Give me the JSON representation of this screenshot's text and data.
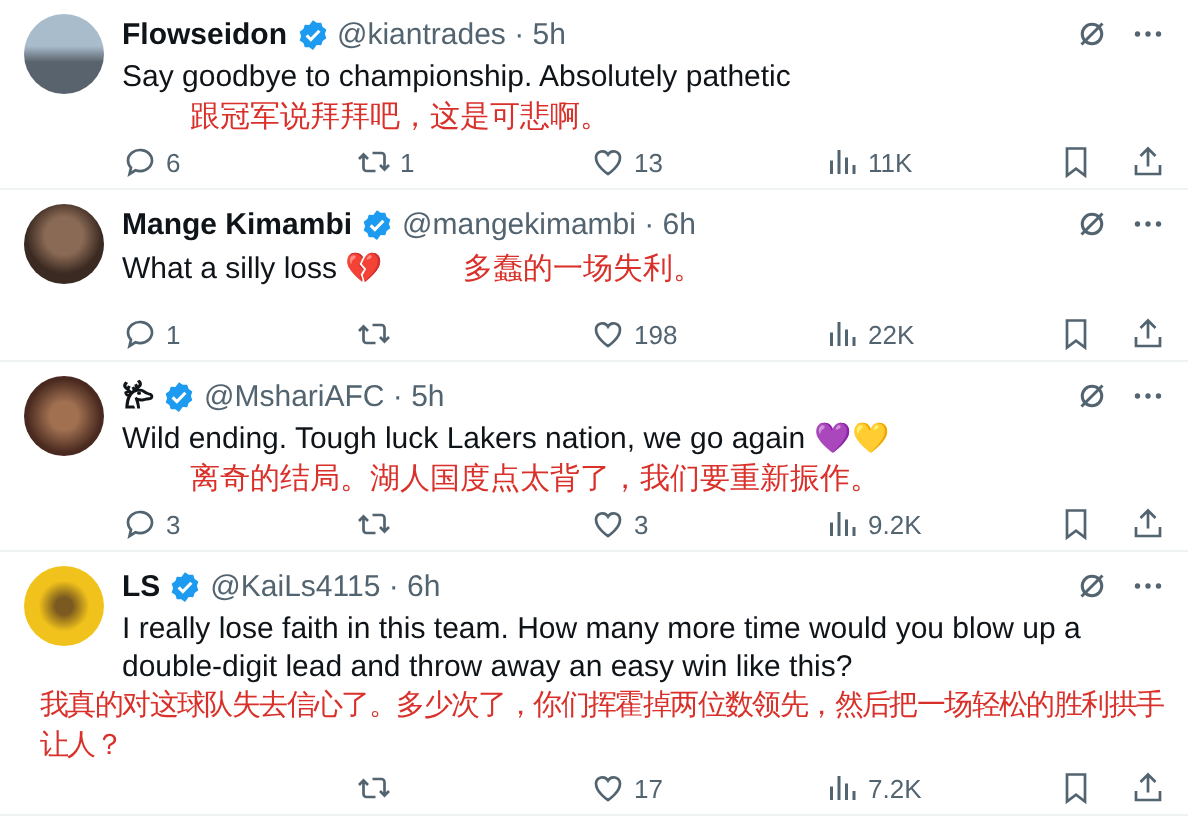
{
  "tweets": [
    {
      "name": "Flowseidon",
      "verified": true,
      "handle": "@kiantrades · 5h",
      "text": "Say goodbye to championship. Absolutely pathetic",
      "translation": {
        "kind": "below",
        "text": "跟冠军说拜拜吧，这是可悲啊。"
      },
      "replies": "6",
      "retweets": "1",
      "likes": "13",
      "views": "11K"
    },
    {
      "name": "Mange Kimambi",
      "verified": true,
      "handle": "@mangekimambi · 6h",
      "text": "What a silly loss 💔",
      "translation": {
        "kind": "inline",
        "text": "多蠢的一场失利。"
      },
      "replies": "1",
      "likes": "198",
      "views": "22K"
    },
    {
      "name": "𐂂",
      "verified": true,
      "handle": "@MshariAFC · 5h",
      "text": "Wild ending. Tough luck Lakers nation, we go again 💜💛",
      "translation": {
        "kind": "below",
        "text": "离奇的结局。湖人国度点太背了，我们要重新振作。"
      },
      "replies": "3",
      "likes": "3",
      "views": "9.2K"
    },
    {
      "name": "LS",
      "verified": true,
      "handle": "@KaiLs4115 · 6h",
      "text": "I really lose faith in this team. How many more time would you blow up a double-digit lead and throw away an easy win like this?",
      "translation": {
        "kind": "full",
        "text": "我真的对这球队失去信心了。多少次了，你们挥霍掉两位数领先，然后把一场轻松的胜利拱手让人？"
      },
      "likes": "17",
      "views": "7.2K"
    }
  ]
}
